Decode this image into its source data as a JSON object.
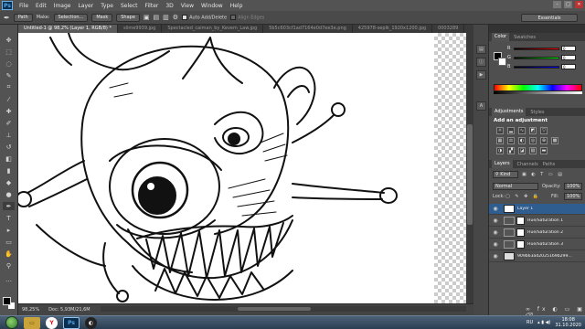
{
  "menu": {
    "logo": "Ps",
    "items": [
      "File",
      "Edit",
      "Image",
      "Layer",
      "Type",
      "Select",
      "Filter",
      "3D",
      "View",
      "Window",
      "Help"
    ]
  },
  "options": {
    "mode": "Path",
    "make_label": "Make:",
    "selection_btn": "Selection...",
    "mask_btn": "Mask",
    "shape_btn": "Shape",
    "auto_add": "Auto Add/Delete",
    "align_edges": "Align Edges",
    "workspace": "Essentials"
  },
  "tabs": [
    "Untitled-1 @ 98,2% (Layer 1, RGB/8) *",
    "slime9939.jpg",
    "Spectacled_caiman_by_Kevem_Law.jpg",
    "5b5c603cf1ad7164e0d7ee3e.png",
    "425978-sepik_1920x1200.jpg",
    "0003289"
  ],
  "status": {
    "zoom": "98,25%",
    "doc": "Doc: 5,93M/21,6M"
  },
  "color_panel": {
    "tabs": [
      "Color",
      "Swatches"
    ],
    "channels": [
      {
        "label": "R",
        "value": "0",
        "color": "#ff3333"
      },
      {
        "label": "G",
        "value": "0",
        "color": "#33dd33"
      },
      {
        "label": "B",
        "value": "0",
        "color": "#3388ff"
      }
    ]
  },
  "adjustments": {
    "tabs": [
      "Adjustments",
      "Styles"
    ],
    "title": "Add an adjustment"
  },
  "layers_panel": {
    "tabs": [
      "Layers",
      "Channels",
      "Paths"
    ],
    "kind": "Kind",
    "blend": "Normal",
    "opacity_label": "Opacity:",
    "opacity": "100%",
    "lock_label": "Lock:",
    "fill_label": "Fill:",
    "fill": "100%",
    "layers": [
      {
        "name": "Layer 1",
        "selected": true,
        "type": "pixel"
      },
      {
        "name": "Hue/Saturation 1",
        "selected": false,
        "type": "adjustment"
      },
      {
        "name": "Hue/Saturation 2",
        "selected": false,
        "type": "adjustment"
      },
      {
        "name": "Hue/Saturation 3",
        "selected": false,
        "type": "adjustment"
      },
      {
        "name": "909b63ad2025169b299...",
        "selected": false,
        "type": "pixel"
      }
    ]
  },
  "taskbar": {
    "lang": "RU",
    "time": "18:08",
    "date": "31.10.2020"
  }
}
